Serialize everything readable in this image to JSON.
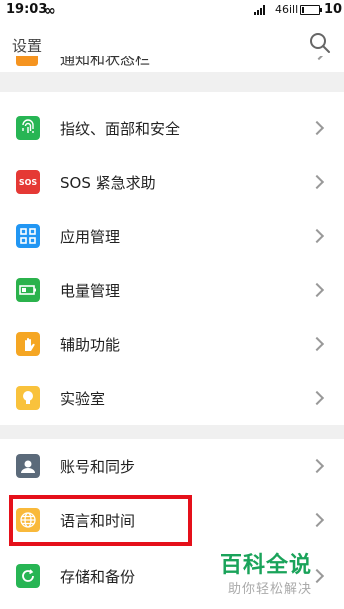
{
  "status_bar": {
    "time": "19:03",
    "loop_symbol": "∞",
    "wifi_text": "46ill",
    "battery": "10"
  },
  "header": {
    "title": "设置"
  },
  "partial_item": {
    "label": "通知和状态栏"
  },
  "groups": [
    {
      "items": [
        {
          "label": "指纹、面部和安全",
          "icon": "fingerprint-icon",
          "color": "#27b554"
        },
        {
          "label": "SOS 紧急求助",
          "icon": "sos-icon",
          "color": "#e53935",
          "icon_text": "SOS"
        },
        {
          "label": "应用管理",
          "icon": "apps-grid-icon",
          "color": "#2196f3"
        },
        {
          "label": "电量管理",
          "icon": "battery-icon",
          "color": "#2bb24c"
        },
        {
          "label": "辅助功能",
          "icon": "hand-icon",
          "color": "#f5a623"
        },
        {
          "label": "实验室",
          "icon": "lightbulb-icon",
          "color": "#f9c23c"
        }
      ]
    },
    {
      "items": [
        {
          "label": "账号和同步",
          "icon": "account-icon",
          "color": "#5b6a7a"
        },
        {
          "label": "语言和时间",
          "icon": "globe-icon",
          "color": "#f9b93b"
        },
        {
          "label": "存储和备份",
          "icon": "storage-icon",
          "color": "#27b554"
        }
      ]
    }
  ],
  "watermark": {
    "title": "百科全说",
    "subtitle": "助你轻松解决"
  },
  "colors": {
    "highlight": "#e5101a",
    "background_gap": "#f0f0f0",
    "watermark": "#1aa35a"
  }
}
